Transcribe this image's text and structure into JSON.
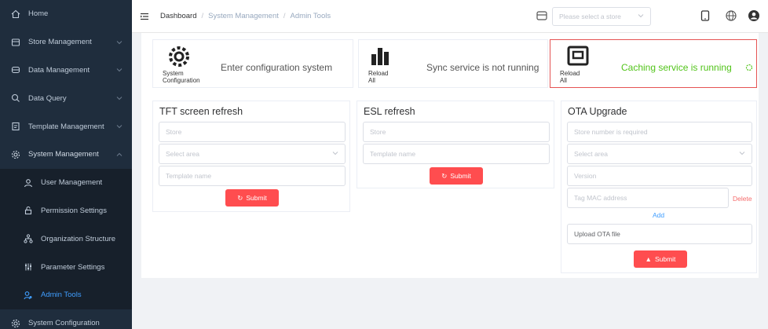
{
  "sidebar": {
    "items": [
      {
        "label": "Home",
        "icon": "home-icon"
      },
      {
        "label": "Store Management",
        "icon": "store-icon"
      },
      {
        "label": "Data Management",
        "icon": "database-icon"
      },
      {
        "label": "Data Query",
        "icon": "search-icon"
      },
      {
        "label": "Template Management",
        "icon": "template-icon"
      },
      {
        "label": "System Management",
        "icon": "settings-icon"
      },
      {
        "label": "User Management",
        "icon": "user-icon"
      },
      {
        "label": "Permission Settings",
        "icon": "lock-icon"
      },
      {
        "label": "Organization Structure",
        "icon": "org-icon"
      },
      {
        "label": "Parameter Settings",
        "icon": "sliders-icon"
      },
      {
        "label": "Admin Tools",
        "icon": "tools-icon"
      },
      {
        "label": "System Configuration",
        "icon": "gear-icon"
      }
    ]
  },
  "topbar": {
    "breadcrumb": [
      "Dashboard",
      "System Management",
      "Admin Tools"
    ],
    "separator": "/",
    "store_placeholder": "Please select a store"
  },
  "stats": [
    {
      "label_line1": "System",
      "label_line2": "Configuration",
      "text": "Enter configuration system"
    },
    {
      "label_line1": "Reload",
      "label_line2": "All",
      "text": "Sync service is not running"
    },
    {
      "label_line1": "Reload",
      "label_line2": "All",
      "text": "Caching service is running"
    }
  ],
  "tft": {
    "title": "TFT screen refresh",
    "store_placeholder": "Store",
    "area_placeholder": "Select area",
    "template_placeholder": "Template name",
    "submit": "Submit"
  },
  "esl": {
    "title": "ESL refresh",
    "store_placeholder": "Store",
    "template_placeholder": "Template name",
    "submit": "Submit"
  },
  "ota": {
    "title": "OTA Upgrade",
    "store_placeholder": "Store number is required",
    "area_placeholder": "Select area",
    "version_placeholder": "Version",
    "mac_placeholder": "Tag MAC address",
    "delete": "Delete",
    "add": "Add",
    "upload": "Upload OTA file",
    "submit": "Submit"
  },
  "colors": {
    "accent": "#409eff",
    "danger": "#ff4d4f",
    "success": "#52c41a",
    "sidebar": "#1f2d3d"
  }
}
